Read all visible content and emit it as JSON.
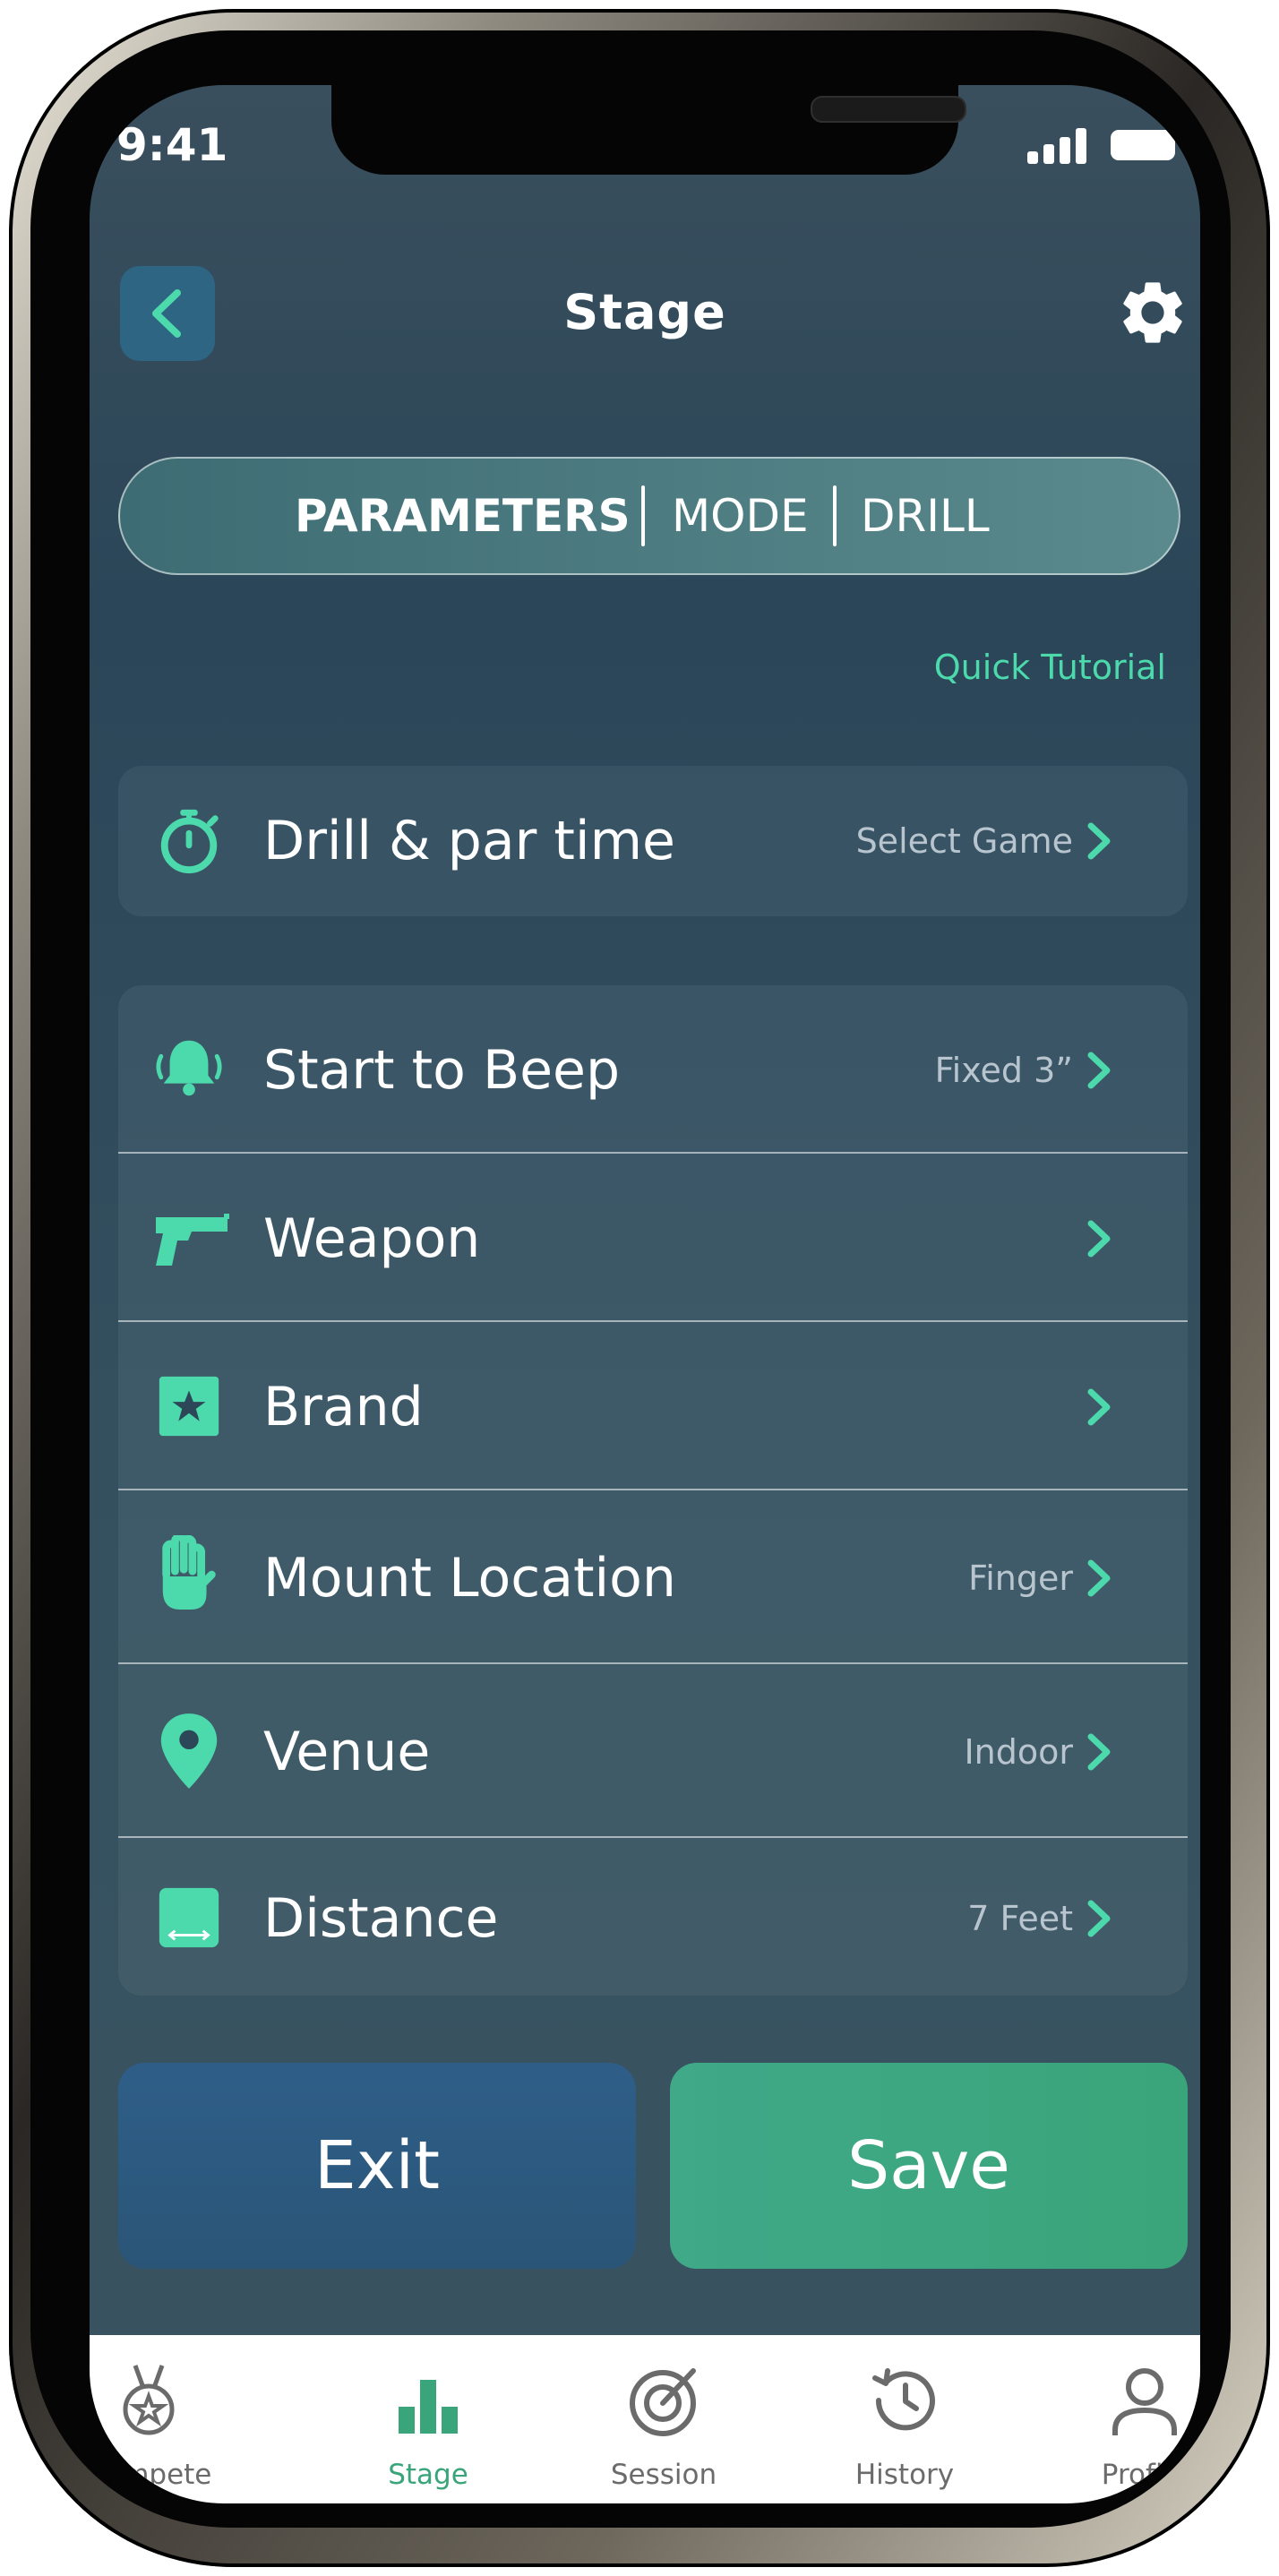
{
  "status_bar": {
    "time": "9:41"
  },
  "header": {
    "title": "Stage"
  },
  "tabs": [
    {
      "label": "PARAMETERS",
      "active": true
    },
    {
      "label": "MODE",
      "active": false
    },
    {
      "label": "DRILL",
      "active": false
    }
  ],
  "quick_tutorial": "Quick Tutorial",
  "drill_row": {
    "label": "Drill & par time",
    "value": "Select Game",
    "icon": "stopwatch-icon"
  },
  "settings_rows": [
    {
      "label": "Start to Beep",
      "value": "Fixed 3”",
      "icon": "bell-icon"
    },
    {
      "label": "Weapon",
      "value": "",
      "icon": "pistol-icon"
    },
    {
      "label": "Brand",
      "value": "",
      "icon": "star-square-icon"
    },
    {
      "label": "Mount Location",
      "value": "Finger",
      "icon": "hand-icon"
    },
    {
      "label": "Venue",
      "value": "Indoor",
      "icon": "location-pin-icon"
    },
    {
      "label": "Distance",
      "value": "7 Feet",
      "icon": "distance-icon"
    }
  ],
  "actions": {
    "exit": "Exit",
    "save": "Save"
  },
  "bottom_nav": [
    {
      "label": "Compete",
      "icon": "medal-icon",
      "active": false
    },
    {
      "label": "Stage",
      "icon": "bar-chart-icon",
      "active": true
    },
    {
      "label": "Session",
      "icon": "target-icon",
      "active": false
    },
    {
      "label": "History",
      "icon": "history-icon",
      "active": false
    },
    {
      "label": "Profile",
      "icon": "user-icon",
      "active": false
    }
  ],
  "colors": {
    "accent": "#4cd9ac",
    "save": "#3aa57a",
    "exit": "#2e5e88",
    "screen_bg": "#2f4b5c",
    "inactive_nav": "#6b6b6b"
  }
}
